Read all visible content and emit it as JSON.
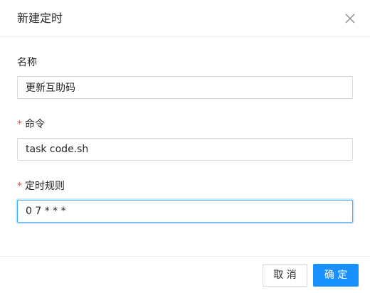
{
  "modal": {
    "title": "新建定时",
    "close_icon": "close-icon"
  },
  "form": {
    "name": {
      "label": "名称",
      "value": "更新互助码",
      "required": false
    },
    "command": {
      "label": "命令",
      "value": "task code.sh",
      "required": true,
      "required_mark": "*"
    },
    "schedule": {
      "label": "定时规则",
      "value": "0 7 * * *",
      "required": true,
      "required_mark": "*"
    }
  },
  "footer": {
    "cancel_label": "取 消",
    "ok_label": "确 定"
  },
  "colors": {
    "primary": "#1890ff",
    "required": "#ff4d4f",
    "focus_border": "#40a9ff",
    "border": "#d9d9d9"
  }
}
